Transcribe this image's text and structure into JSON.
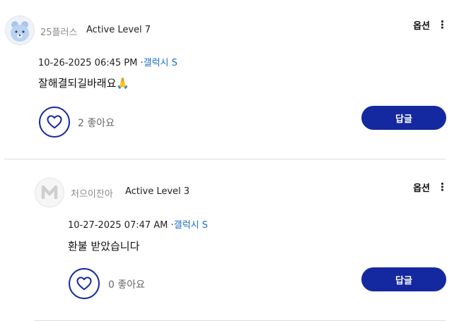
{
  "posts": [
    {
      "username": "25플러스",
      "level": "Active Level 7",
      "options_label": "옵션",
      "date": "10-26-2025 06:45 PM",
      "separator": "·",
      "device": "갤럭시 S",
      "text": "잘해결되길바래요",
      "emoji": "🙏",
      "likes": "2 좋아요",
      "reply_label": "답글"
    },
    {
      "username": "처으이잔아",
      "level": "Active Level 3",
      "options_label": "옵션",
      "date": "10-27-2025 07:47 AM",
      "separator": "·",
      "device": "갤럭시 S",
      "text": "환불 받았습니다",
      "likes": "0 좋아요",
      "reply_label": "답글"
    }
  ],
  "colors": {
    "accent": "#1428a0",
    "link": "#1a6fc4",
    "divider": "#dcdcdc"
  }
}
